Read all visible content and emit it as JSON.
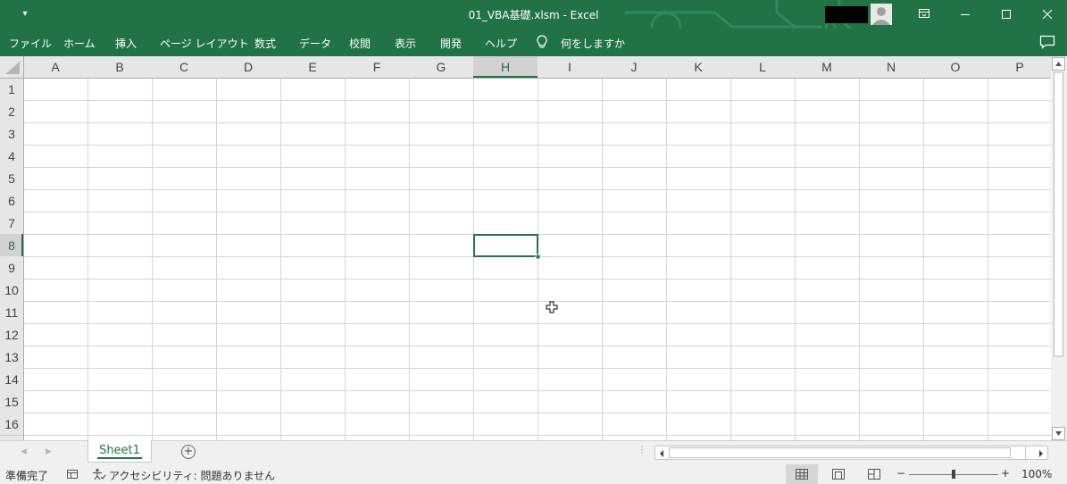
{
  "window": {
    "title": "01_VBA基礎.xlsm  -  Excel",
    "qat_icon": "customize-qat-icon",
    "window_controls": [
      "ribbon-display-options-icon",
      "minimize-icon",
      "maximize-icon",
      "close-icon"
    ]
  },
  "ribbon": {
    "tabs": [
      "ファイル",
      "ホーム",
      "挿入",
      "ページ レイアウト",
      "数式",
      "データ",
      "校閲",
      "表示",
      "開発",
      "ヘルプ"
    ],
    "tell_me": "何をしますか",
    "comments_icon": "comments-icon"
  },
  "grid": {
    "columns": [
      "A",
      "B",
      "C",
      "D",
      "E",
      "F",
      "G",
      "H",
      "I",
      "J",
      "K",
      "L",
      "M",
      "N",
      "O",
      "P"
    ],
    "rows": [
      "1",
      "2",
      "3",
      "4",
      "5",
      "6",
      "7",
      "8",
      "9",
      "10",
      "11",
      "12",
      "13",
      "14",
      "15",
      "16"
    ],
    "selected_column": "H",
    "selected_row": "8",
    "cells": []
  },
  "sheet_tabs": {
    "tabs": [
      "Sheet1"
    ],
    "active": "Sheet1",
    "add_icon": "new-sheet-icon"
  },
  "status": {
    "ready": "準備完了",
    "accessibility": "アクセシビリティ: 問題ありません",
    "zoom": "100%",
    "zoom_level": 1.0,
    "minus": "−",
    "plus": "+"
  },
  "colors": {
    "accent": "#217346",
    "header_bg": "#e6e6e6",
    "header_selected_bg": "#d2d2d2",
    "gridline": "#d4d4d4"
  }
}
